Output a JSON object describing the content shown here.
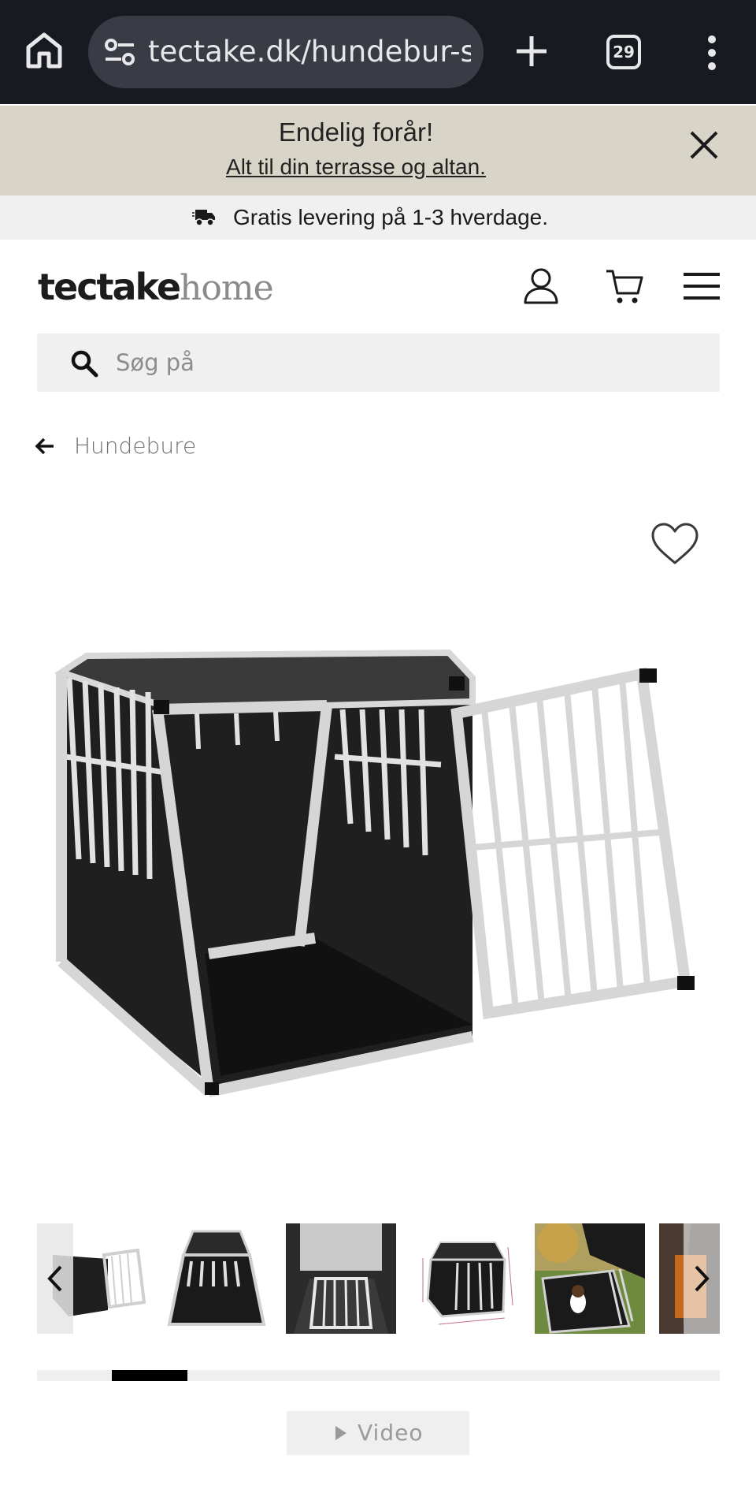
{
  "browser": {
    "url": "tectake.dk/hundebur-single",
    "tab_count": "29",
    "icons": [
      "home-icon",
      "site-settings-icon",
      "new-tab-icon",
      "tabs-icon",
      "more-menu-icon"
    ]
  },
  "promo": {
    "title": "Endelig forår!",
    "link": "Alt til din terrasse og altan."
  },
  "delivery": {
    "text": "Gratis levering på 1-3 hverdage."
  },
  "header": {
    "logo_bold": "tectake",
    "logo_light": "home",
    "icons": [
      "account-icon",
      "cart-icon",
      "menu-icon"
    ]
  },
  "search": {
    "placeholder": "Søg på"
  },
  "breadcrumb": {
    "label": "Hundebure"
  },
  "gallery": {
    "thumbnail_count": 6,
    "progress_start": 0.11,
    "progress_fraction": 0.11
  },
  "video": {
    "label": "Video"
  },
  "colors": {
    "chrome_bg": "#181a22",
    "promo_bg": "#d8d5c8",
    "delivery_bg": "#f0f0f0"
  }
}
